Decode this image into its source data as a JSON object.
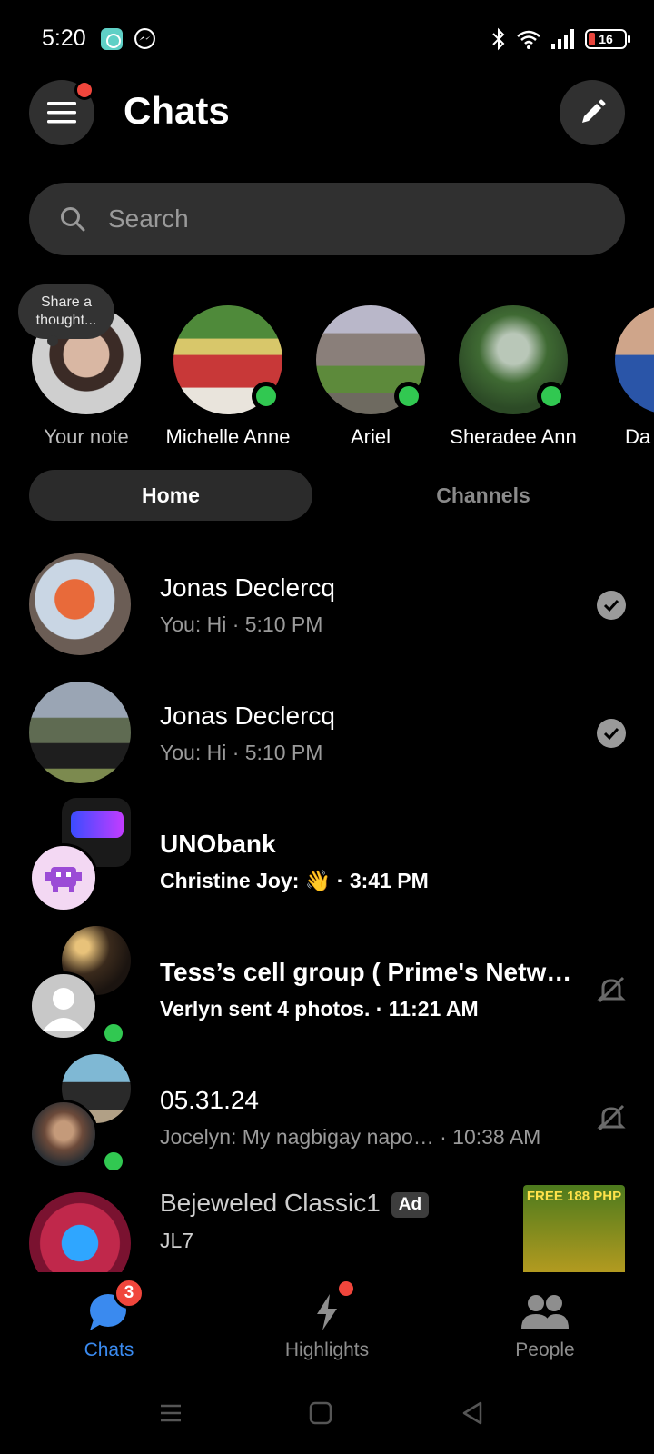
{
  "status_bar": {
    "time": "5:20",
    "battery": "16",
    "icons": [
      "app-icon",
      "messenger-icon",
      "bluetooth-icon",
      "wifi-icon",
      "signal-icon",
      "battery-icon"
    ]
  },
  "header": {
    "title": "Chats"
  },
  "search": {
    "placeholder": "Search"
  },
  "note": {
    "text": "Share a thought..."
  },
  "stories": [
    {
      "name": "Your note",
      "online": false
    },
    {
      "name": "Michelle Anne",
      "online": true
    },
    {
      "name": "Ariel",
      "online": true
    },
    {
      "name": "Sheradee Ann",
      "online": true
    },
    {
      "name": "Da",
      "online": false
    }
  ],
  "tabs": {
    "home": "Home",
    "channels": "Channels"
  },
  "chats": [
    {
      "title": "Jonas Declercq",
      "subtitle": "You: Hi · 5:10 PM",
      "status": "read-check-icon",
      "unread": false
    },
    {
      "title": "Jonas Declercq",
      "subtitle": "You: Hi · 5:10 PM",
      "status": "read-check-icon",
      "unread": false
    },
    {
      "title": "UNObank",
      "subtitle": "Christine Joy: 👋 · 3:41 PM",
      "status": "",
      "unread": true
    },
    {
      "title": "Tess’s cell group ( Prime's Netw…",
      "subtitle": "Verlyn sent 4 photos. · 11:21 AM",
      "status": "muted-bell-icon",
      "unread": true
    },
    {
      "title": "05.31.24",
      "subtitle": "Jocelyn: My nagbigay napo… · 10:38 AM",
      "status": "muted-bell-icon",
      "unread": false
    },
    {
      "title": "Bejeweled Classic1",
      "subtitle": "JL7",
      "badge": "Ad",
      "unread": false
    }
  ],
  "ad_thumb_text": "FREE 188 PHP",
  "bottom_nav": {
    "chats": "Chats",
    "chats_badge": "3",
    "highlights": "Highlights",
    "people": "People"
  },
  "colors": {
    "accent": "#3a8aef",
    "online": "#31c851",
    "badge": "#f0463c",
    "surface": "#303030"
  }
}
